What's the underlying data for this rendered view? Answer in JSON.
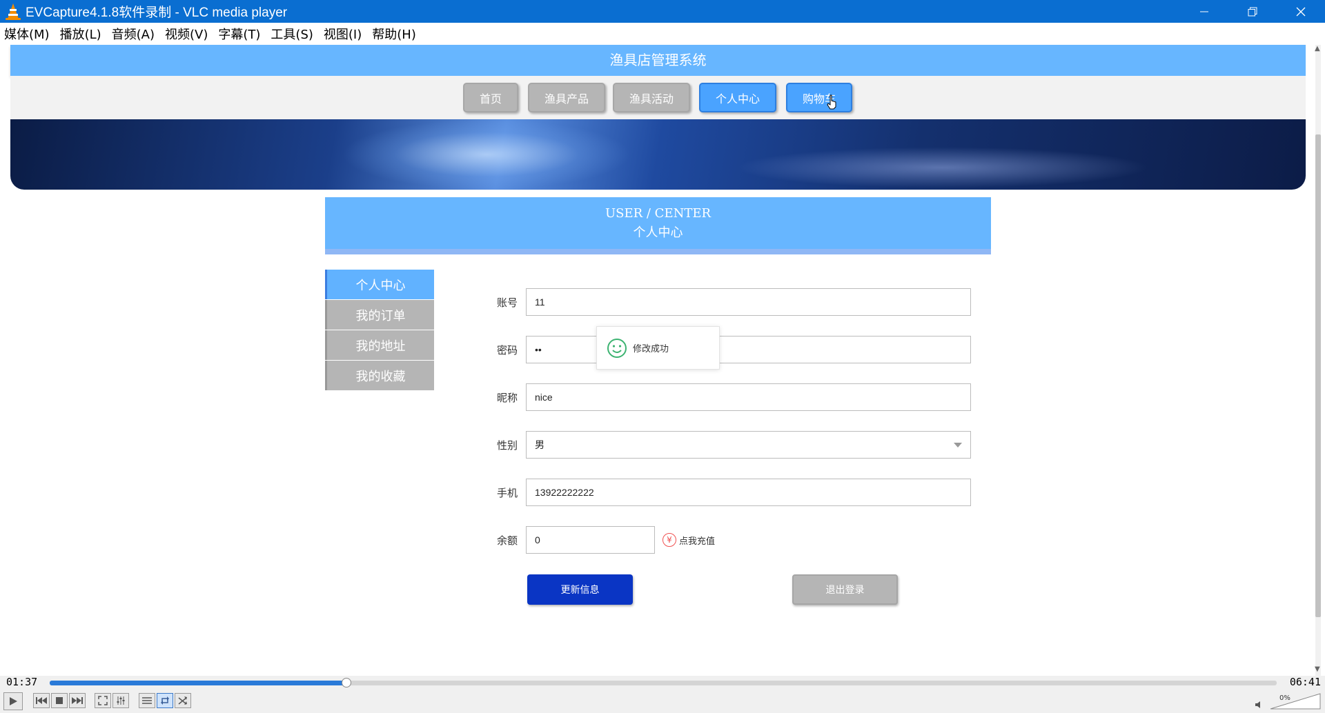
{
  "window": {
    "title": "EVCapture4.1.8软件录制 - VLC media player"
  },
  "menu": [
    "媒体(M)",
    "播放(L)",
    "音频(A)",
    "视频(V)",
    "字幕(T)",
    "工具(S)",
    "视图(I)",
    "帮助(H)"
  ],
  "site": {
    "title": "渔具店管理系统",
    "nav": [
      "首页",
      "渔具产品",
      "渔具活动",
      "个人中心",
      "购物车"
    ]
  },
  "section": {
    "en": "USER / CENTER",
    "cn": "个人中心"
  },
  "sidebar": [
    "个人中心",
    "我的订单",
    "我的地址",
    "我的收藏"
  ],
  "form": {
    "account_label": "账号",
    "account_value": "11",
    "password_label": "密码",
    "password_value": "••",
    "nickname_label": "昵称",
    "nickname_value": "nice",
    "gender_label": "性别",
    "gender_value": "男",
    "phone_label": "手机",
    "phone_value": "13922222222",
    "balance_label": "余额",
    "balance_value": "0",
    "recharge_symbol": "¥",
    "recharge_label": "点我充值",
    "update_button": "更新信息",
    "logout_button": "退出登录"
  },
  "toast": {
    "message": "修改成功"
  },
  "player": {
    "elapsed": "01:37",
    "total": "06:41",
    "progress_fraction": 0.242,
    "volume_label": "0%"
  },
  "colors": {
    "titlebar": "#0a6ed1",
    "site_header": "#67b6ff",
    "nav_active": "#4aa3ff",
    "update_button": "#0a35c4",
    "toast_icon": "#3cb371"
  }
}
